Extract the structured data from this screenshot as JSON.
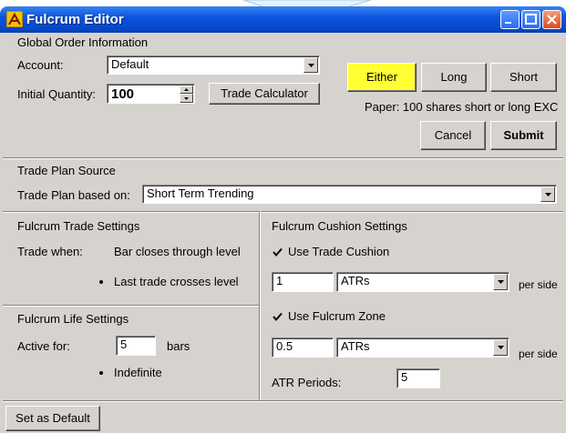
{
  "window": {
    "title": "Fulcrum Editor"
  },
  "global_order": {
    "section_label": "Global Order Information",
    "account_label": "Account:",
    "account_value": "Default",
    "initial_quantity_label": "Initial Quantity:",
    "initial_quantity_value": "100",
    "trade_calculator_label": "Trade Calculator",
    "direction_buttons": {
      "either": "Either",
      "long": "Long",
      "short": "Short"
    },
    "paper_status": "Paper: 100 shares short or long EXC",
    "cancel_label": "Cancel",
    "submit_label": "Submit"
  },
  "trade_plan": {
    "section_label": "Trade Plan Source",
    "based_on_label": "Trade Plan based on:",
    "based_on_value": "Short Term Trending"
  },
  "trade_settings": {
    "section_label": "Fulcrum Trade Settings",
    "trade_when_label": "Trade when:",
    "option_bar_closes": "Bar closes through level",
    "option_last_trade": "Last trade crosses level"
  },
  "life_settings": {
    "section_label": "Fulcrum Life Settings",
    "active_for_label": "Active for:",
    "bars_value": "5",
    "bars_label": "bars",
    "indefinite_label": "Indefinite"
  },
  "cushion_settings": {
    "section_label": "Fulcrum Cushion Settings",
    "use_trade_cushion_label": "Use Trade Cushion",
    "cushion_value": "1",
    "cushion_unit": "ATRs",
    "per_side_label_1": "per side",
    "use_fulcrum_zone_label": "Use Fulcrum Zone",
    "zone_value": "0.5",
    "zone_unit": "ATRs",
    "per_side_label_2": "per side",
    "atr_periods_label": "ATR Periods:",
    "atr_periods_value": "5"
  },
  "footer": {
    "set_default_label": "Set as Default"
  },
  "colors": {
    "either_active": "#ffff33",
    "titlebar": "#0a55e0",
    "dialog_bg": "#d6d3ce"
  }
}
